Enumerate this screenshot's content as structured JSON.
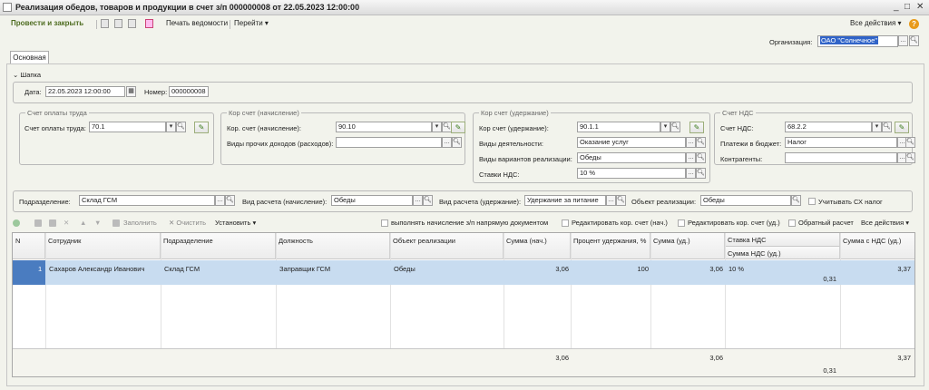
{
  "window": {
    "title": "Реализация обедов, товаров и продукции в счет з/п 000000008 от 22.05.2023 12:00:00"
  },
  "toolbar": {
    "post_close": "Провести и закрыть",
    "print": "Печать ведомости",
    "goto": "Перейти",
    "all_actions": "Все действия",
    "help": "?"
  },
  "org": {
    "label": "Организация:",
    "value": "ОАО \"Солнечное\""
  },
  "tabs": {
    "main": "Основная"
  },
  "header_section": {
    "toggle": "Шапка",
    "date_label": "Дата:",
    "date_value": "22.05.2023 12:00:00",
    "number_label": "Номер:",
    "number_value": "000000008"
  },
  "payroll": {
    "caption": "Счет оплаты труда",
    "label": "Счет оплаты труда:",
    "value": "70.1"
  },
  "kor_accrual": {
    "caption": "Кор счет (начисление)",
    "acc_label": "Кор. счет (начисление):",
    "acc_value": "90.10",
    "income_label": "Виды прочих доходов (расходов):",
    "income_value": ""
  },
  "kor_deduction": {
    "caption": "Кор счет (удержание)",
    "acc_label": "Кор счет (удержание):",
    "acc_value": "90.1.1",
    "activity_label": "Виды деятельности:",
    "activity_value": "Оказание услуг",
    "variant_label": "Виды вариантов реализации:",
    "variant_value": "Обеды",
    "vat_label": "Ставки НДС:",
    "vat_value": "10 %"
  },
  "vat": {
    "caption": "Счет НДС",
    "acc_label": "Счет НДС:",
    "acc_value": "68.2.2",
    "budget_label": "Платежи в бюджет:",
    "budget_value": "Налог",
    "contr_label": "Контрагенты:",
    "contr_value": ""
  },
  "bottom_fields": {
    "dept_label": "Подразделение:",
    "dept_value": "Склад ГСМ",
    "calc_acc_label": "Вид расчета (начисление):",
    "calc_acc_value": "Обеды",
    "calc_ded_label": "Вид расчета (удержание):",
    "calc_ded_value": "Удержание за питание",
    "obj_label": "Объект реализации:",
    "obj_value": "Обеды",
    "sh_label": "Учитывать СХ налог"
  },
  "grid_toolbar": {
    "fill": "Заполнить",
    "clear": "Очистить",
    "set": "Установить",
    "direct": "выполнять начисление з/п напрямую документом",
    "edit_acc": "Редактировать кор. счет (нач.)",
    "edit_ded": "Редактировать кор. счет (уд.)",
    "reverse": "Обратный расчет",
    "all": "Все действия"
  },
  "grid": {
    "columns": [
      "N",
      "Сотрудник",
      "Подразделение",
      "Должность",
      "Объект реализации",
      "Сумма (нач.)",
      "Процент удержания, %",
      "Сумма (уд.)",
      "Ставка НДС",
      "Сумма с НДС (уд.)"
    ],
    "sub_column": "Сумма НДС (уд.)",
    "rows": [
      {
        "n": "1",
        "employee": "Сахаров Александр Иванович",
        "dept": "Склад ГСМ",
        "position": "Заправщик ГСМ",
        "object": "Обеды",
        "sum_acc": "3,06",
        "percent": "100",
        "sum_ded": "3,06",
        "vat_rate": "10 %",
        "vat_sum": "0,31",
        "sum_vat": "3,37"
      }
    ],
    "totals": {
      "sum_acc": "3,06",
      "sum_ded": "3,06",
      "vat_sum": "0,31",
      "sum_vat": "3,37"
    }
  }
}
